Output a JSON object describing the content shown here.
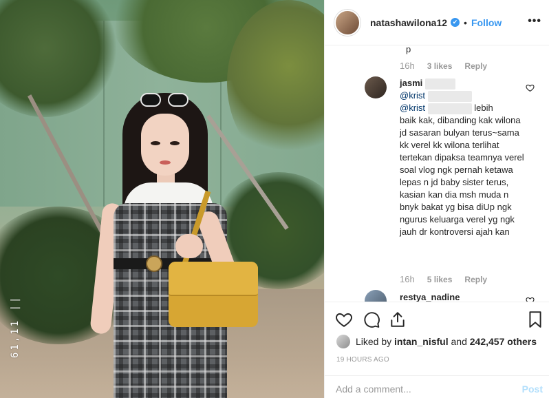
{
  "photo": {
    "overlay_text": "61,11 ||"
  },
  "header": {
    "username": "natashawilona12",
    "verified_glyph": "✔",
    "separator": "•",
    "follow_label": "Follow",
    "more_label": "•••"
  },
  "comments": {
    "fragment_top": "p",
    "first_meta": {
      "time": "16h",
      "likes": "3 likes",
      "reply": "Reply"
    },
    "reply_comment": {
      "username": "jasmi",
      "mention1": "@krist",
      "mention2": "@krist",
      "text_tail": "lebih",
      "text": "baik kak, dibanding kak wilona jd sasaran bulyan terus~sama kk verel kk wilona terlihat tertekan dipaksa teamnya verel soal vlog ngk pernah ketawa lepas n jd baby sister terus, kasian kan dia msh muda n bnyk bakat yg bisa diUp ngk ngurus keluarga verel yg ngk jauh dr kontroversi ajah kan",
      "meta": {
        "time": "16h",
        "likes": "5 likes",
        "reply": "Reply"
      }
    },
    "next_comment": {
      "username": "restya_nadine"
    }
  },
  "actions": {
    "liked_by_prefix": "Liked by",
    "liked_by_user": "intan_nisful",
    "liked_by_and": "and",
    "liked_by_count": "242,457 others",
    "timestamp": "19 HOURS AGO",
    "comment_placeholder": "Add a comment...",
    "post_label": "Post"
  },
  "icons": {
    "verified": "verified-badge-icon",
    "more": "more-options-icon",
    "like": "heart-icon",
    "comment": "comment-bubble-icon",
    "share": "share-icon",
    "save": "bookmark-icon",
    "comment_like": "small-heart-icon"
  },
  "colors": {
    "link_blue": "#3897f0",
    "mention_blue": "#003569",
    "muted_gray": "#999999",
    "post_disabled": "#b2dffc"
  }
}
